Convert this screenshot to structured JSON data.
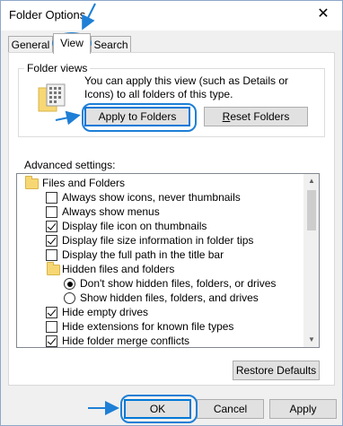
{
  "window": {
    "title": "Folder Options",
    "close_glyph": "✕"
  },
  "tabs": [
    {
      "label": "General",
      "active": false
    },
    {
      "label": "View",
      "active": true
    },
    {
      "label": "Search",
      "active": false
    }
  ],
  "folder_views": {
    "group_label": "Folder views",
    "description": "You can apply this view (such as Details or Icons) to all folders of this type.",
    "apply_button": "Apply to Folders",
    "reset_button": "Reset Folders",
    "reset_mnemonic": "R"
  },
  "advanced": {
    "label": "Advanced settings:",
    "items": [
      {
        "type": "folder",
        "label": "Files and Folders"
      },
      {
        "type": "checkbox",
        "label": "Always show icons, never thumbnails",
        "checked": false
      },
      {
        "type": "checkbox",
        "label": "Always show menus",
        "checked": false
      },
      {
        "type": "checkbox",
        "label": "Display file icon on thumbnails",
        "checked": true
      },
      {
        "type": "checkbox",
        "label": "Display file size information in folder tips",
        "checked": true
      },
      {
        "type": "checkbox",
        "label": "Display the full path in the title bar",
        "checked": false
      },
      {
        "type": "folder",
        "label": "Hidden files and folders"
      },
      {
        "type": "radio",
        "label": "Don't show hidden files, folders, or drives",
        "checked": true
      },
      {
        "type": "radio",
        "label": "Show hidden files, folders, and drives",
        "checked": false
      },
      {
        "type": "checkbox",
        "label": "Hide empty drives",
        "checked": true
      },
      {
        "type": "checkbox",
        "label": "Hide extensions for known file types",
        "checked": false
      },
      {
        "type": "checkbox",
        "label": "Hide folder merge conflicts",
        "checked": true
      }
    ]
  },
  "restore_button": "Restore Defaults",
  "footer": {
    "ok": "OK",
    "cancel": "Cancel",
    "apply": "Apply"
  },
  "colors": {
    "annotation": "#1e7fd6",
    "focus": "#0078d7"
  }
}
